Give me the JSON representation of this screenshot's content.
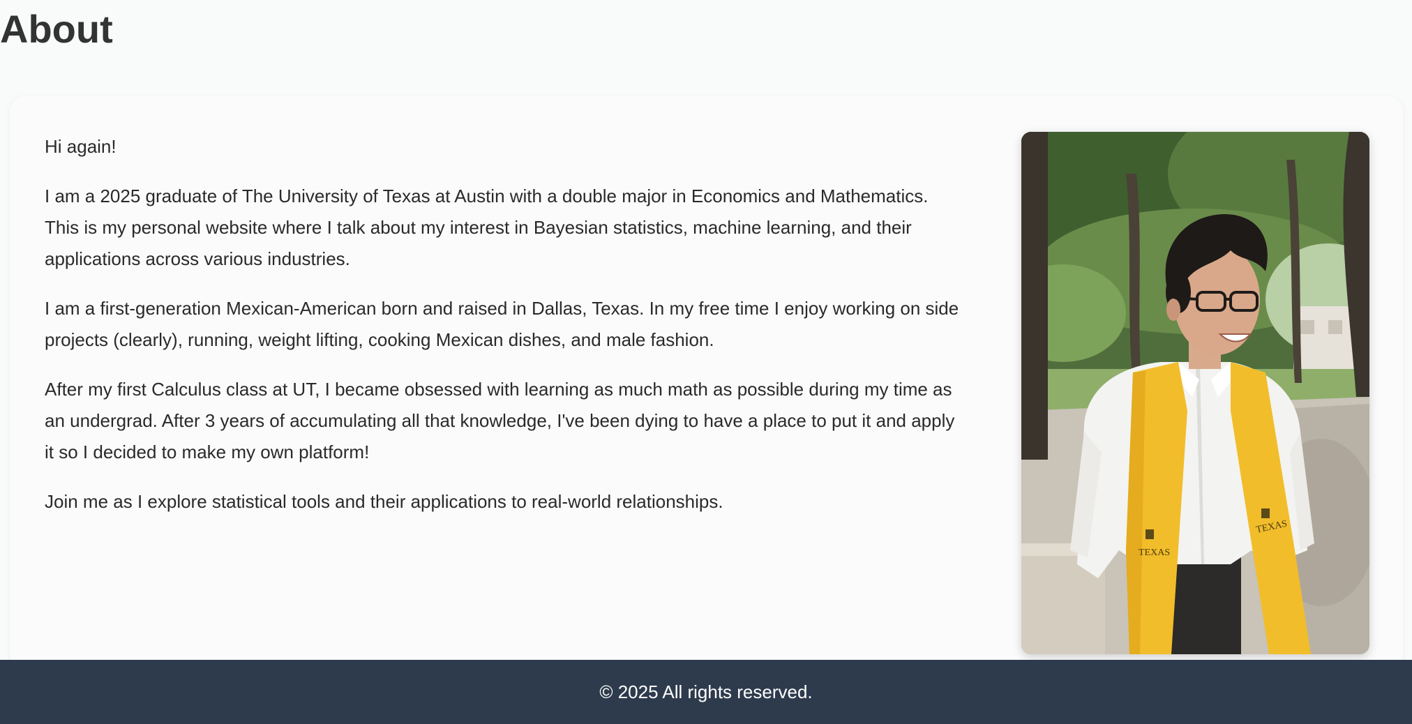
{
  "header": {
    "title": "About"
  },
  "about": {
    "greeting": "Hi again!",
    "paragraphs": [
      "I am a 2025 graduate of The University of Texas at Austin with a double major in Economics and Mathematics. This is my personal website where I talk about my interest in Bayesian statistics, machine learning, and their applications across various industries.",
      "I am a first-generation Mexican-American born and raised in Dallas, Texas. In my free time I enjoy working on side projects (clearly), running, weight lifting, cooking Mexican dishes, and male fashion.",
      "After my first Calculus class at UT, I became obsessed with learning as much math as possible during my time as an undergrad. After 3 years of accumulating all that knowledge, I've been dying to have a place to put it and apply it so I decided to make my own platform!",
      "Join me as I explore statistical tools and their applications to real-world relationships."
    ],
    "photo": {
      "stole_text": "TEXAS"
    }
  },
  "footer": {
    "copyright": "© 2025 All rights reserved."
  },
  "colors": {
    "background": "#f9fafa",
    "card": "#fbfbfc",
    "footer": "#2e3b4d",
    "text": "#2a2a2a",
    "stole": "#f2bd2a"
  }
}
